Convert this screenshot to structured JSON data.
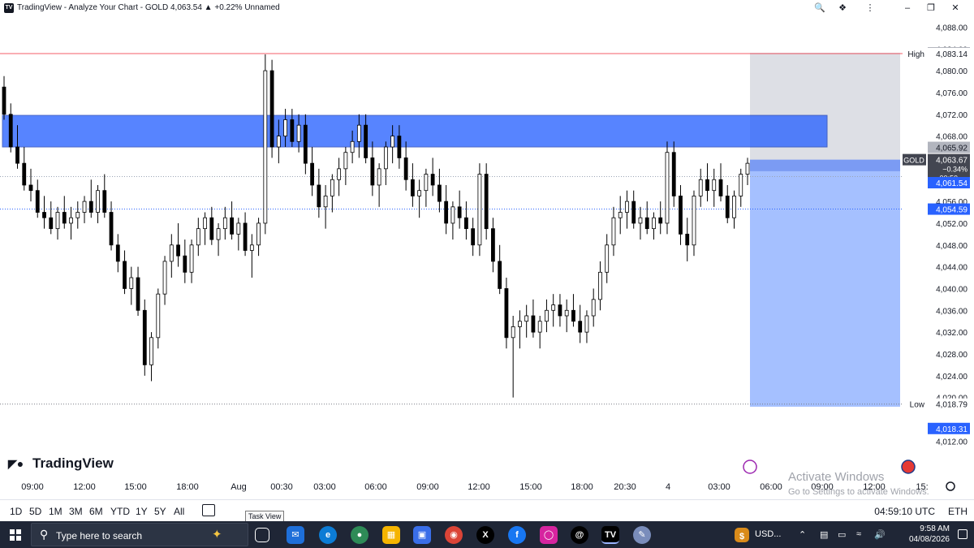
{
  "window": {
    "title": "TradingView - Analyze Your Chart - GOLD 4,063.54 ▲ +0.22% Unnamed",
    "app_icon": "TV",
    "icons": [
      "zoom-icon",
      "pin-icon",
      "extension-icon",
      "more-icon",
      "minimize-icon",
      "restore-icon",
      "close-icon"
    ]
  },
  "chart": {
    "symbol": "GOLD",
    "brand": "TradingView",
    "price_axis": {
      "ticks": [
        "4,088.00",
        "4,084.00",
        "4,080.00",
        "4,076.00",
        "4,072.00",
        "4,068.00",
        "4,064.00",
        "4,060.00",
        "4,056.00",
        "4,052.00",
        "4,048.00",
        "4,044.00",
        "4,040.00",
        "4,036.00",
        "4,032.00",
        "4,028.00",
        "4,024.00",
        "4,020.00",
        "4,012.00"
      ],
      "tick_values": [
        4088,
        4084,
        4080,
        4076,
        4072,
        4068,
        4064,
        4060,
        4056,
        4052,
        4048,
        4044,
        4040,
        4036,
        4032,
        4028,
        4024,
        4020,
        4012
      ]
    },
    "labels": {
      "high_label": "High",
      "high_value": "4,083.14",
      "high_top": "4,083.29",
      "zone_top": "4,065.92",
      "gold_tag": "GOLD",
      "gold_price": "4,063.67",
      "gold_change": "−0.34%",
      "gold_countdown": "00:50",
      "entry": "4,061.54",
      "blue_line": "4,054.59",
      "low_label": "Low",
      "low_value": "4,018.79",
      "low_bottom": "4,018.31"
    },
    "time_axis": [
      "09:00",
      "12:00",
      "15:00",
      "18:00",
      "Aug",
      "00:30",
      "03:00",
      "06:00",
      "09:00",
      "12:00",
      "15:00",
      "18:00",
      "20:30",
      "4",
      "03:00",
      "06:00",
      "09:00",
      "12:00",
      "15:"
    ],
    "watermark": {
      "title": "Activate Windows",
      "subtitle": "Go to Settings to activate Windows."
    },
    "colors": {
      "up": "#ffffff",
      "down": "#000000",
      "zone": "#2962ff",
      "stop_zone": "#d1d4dc",
      "target_zone": "#8fb0ff",
      "high_line": "#f23645",
      "dotted": "#2962ff"
    }
  },
  "chart_data": {
    "type": "candlestick",
    "symbol": "GOLD",
    "last": 4063.67,
    "high": 4083.14,
    "low": 4018.79,
    "ylim": [
      4011,
      4090
    ],
    "zones": {
      "supply": [
        4066.0,
        4071.8
      ],
      "sl": [
        4061.54,
        4083.29
      ],
      "entry_band": [
        4061.54,
        4063.67
      ],
      "tp": [
        4018.31,
        4061.54
      ]
    },
    "candles": [
      [
        4077,
        4079,
        4071,
        4072
      ],
      [
        4072,
        4074,
        4065,
        4066
      ],
      [
        4066,
        4070,
        4062,
        4063
      ],
      [
        4063,
        4066,
        4058,
        4059
      ],
      [
        4059,
        4062,
        4056,
        4058
      ],
      [
        4058,
        4060,
        4053,
        4054
      ],
      [
        4054,
        4057,
        4051,
        4053
      ],
      [
        4053,
        4056,
        4050,
        4051
      ],
      [
        4051,
        4055,
        4049,
        4054
      ],
      [
        4054,
        4057,
        4051,
        4052
      ],
      [
        4052,
        4055,
        4049,
        4053
      ],
      [
        4053,
        4056,
        4051,
        4054
      ],
      [
        4054,
        4057,
        4052,
        4056
      ],
      [
        4056,
        4060,
        4053,
        4054
      ],
      [
        4054,
        4059,
        4052,
        4058
      ],
      [
        4058,
        4061,
        4053,
        4054
      ],
      [
        4054,
        4056,
        4047,
        4048
      ],
      [
        4048,
        4050,
        4043,
        4045
      ],
      [
        4045,
        4047,
        4039,
        4040
      ],
      [
        4040,
        4044,
        4037,
        4042
      ],
      [
        4042,
        4044,
        4035,
        4036
      ],
      [
        4036,
        4038,
        4024,
        4026
      ],
      [
        4026,
        4032,
        4023,
        4031
      ],
      [
        4031,
        4040,
        4029,
        4039
      ],
      [
        4039,
        4046,
        4037,
        4045
      ],
      [
        4045,
        4050,
        4042,
        4048
      ],
      [
        4048,
        4052,
        4044,
        4046
      ],
      [
        4046,
        4049,
        4041,
        4043
      ],
      [
        4043,
        4049,
        4041,
        4048
      ],
      [
        4048,
        4053,
        4046,
        4051
      ],
      [
        4051,
        4054,
        4048,
        4053
      ],
      [
        4053,
        4055,
        4048,
        4049
      ],
      [
        4049,
        4052,
        4046,
        4051
      ],
      [
        4051,
        4055,
        4049,
        4053
      ],
      [
        4053,
        4056,
        4049,
        4050
      ],
      [
        4050,
        4053,
        4047,
        4052
      ],
      [
        4052,
        4054,
        4046,
        4047
      ],
      [
        4047,
        4050,
        4042,
        4048
      ],
      [
        4048,
        4053,
        4046,
        4052
      ],
      [
        4052,
        4083,
        4050,
        4080
      ],
      [
        4080,
        4082,
        4064,
        4066
      ],
      [
        4066,
        4071,
        4063,
        4068
      ],
      [
        4068,
        4073,
        4066,
        4071
      ],
      [
        4071,
        4073,
        4066,
        4067
      ],
      [
        4067,
        4072,
        4065,
        4070
      ],
      [
        4070,
        4072,
        4061,
        4063
      ],
      [
        4063,
        4066,
        4057,
        4059
      ],
      [
        4059,
        4062,
        4053,
        4055
      ],
      [
        4055,
        4059,
        4051,
        4057
      ],
      [
        4057,
        4061,
        4054,
        4060
      ],
      [
        4060,
        4064,
        4057,
        4062
      ],
      [
        4062,
        4066,
        4059,
        4065
      ],
      [
        4065,
        4069,
        4063,
        4067
      ],
      [
        4067,
        4072,
        4064,
        4070
      ],
      [
        4070,
        4072,
        4063,
        4064
      ],
      [
        4064,
        4067,
        4057,
        4059
      ],
      [
        4059,
        4063,
        4055,
        4062
      ],
      [
        4062,
        4067,
        4059,
        4066
      ],
      [
        4066,
        4070,
        4063,
        4068
      ],
      [
        4068,
        4070,
        4062,
        4064
      ],
      [
        4064,
        4067,
        4058,
        4060
      ],
      [
        4060,
        4063,
        4055,
        4057
      ],
      [
        4057,
        4060,
        4053,
        4058
      ],
      [
        4058,
        4062,
        4055,
        4061
      ],
      [
        4061,
        4064,
        4057,
        4059
      ],
      [
        4059,
        4062,
        4054,
        4056
      ],
      [
        4056,
        4059,
        4050,
        4052
      ],
      [
        4052,
        4056,
        4049,
        4055
      ],
      [
        4055,
        4058,
        4051,
        4053
      ],
      [
        4053,
        4056,
        4049,
        4051
      ],
      [
        4051,
        4053,
        4046,
        4048
      ],
      [
        4048,
        4063,
        4046,
        4061
      ],
      [
        4061,
        4063,
        4049,
        4051
      ],
      [
        4051,
        4053,
        4043,
        4045
      ],
      [
        4045,
        4048,
        4039,
        4040
      ],
      [
        4040,
        4042,
        4029,
        4031
      ],
      [
        4031,
        4035,
        4020,
        4033
      ],
      [
        4033,
        4036,
        4029,
        4034
      ],
      [
        4034,
        4037,
        4031,
        4035
      ],
      [
        4035,
        4038,
        4031,
        4032
      ],
      [
        4032,
        4035,
        4029,
        4034
      ],
      [
        4034,
        4038,
        4032,
        4036
      ],
      [
        4036,
        4039,
        4033,
        4037
      ],
      [
        4037,
        4039,
        4033,
        4035
      ],
      [
        4035,
        4038,
        4032,
        4036
      ],
      [
        4036,
        4039,
        4033,
        4034
      ],
      [
        4034,
        4037,
        4030,
        4032
      ],
      [
        4032,
        4036,
        4030,
        4035
      ],
      [
        4035,
        4040,
        4033,
        4038
      ],
      [
        4038,
        4045,
        4036,
        4043
      ],
      [
        4043,
        4050,
        4041,
        4048
      ],
      [
        4048,
        4055,
        4046,
        4053
      ],
      [
        4053,
        4057,
        4050,
        4054
      ],
      [
        4054,
        4058,
        4051,
        4056
      ],
      [
        4056,
        4058,
        4051,
        4052
      ],
      [
        4052,
        4055,
        4049,
        4053
      ],
      [
        4053,
        4056,
        4050,
        4051
      ],
      [
        4051,
        4054,
        4049,
        4053
      ],
      [
        4053,
        4056,
        4050,
        4052
      ],
      [
        4052,
        4067,
        4050,
        4065
      ],
      [
        4065,
        4067,
        4055,
        4057
      ],
      [
        4057,
        4059,
        4048,
        4050
      ],
      [
        4050,
        4053,
        4045,
        4048
      ],
      [
        4048,
        4058,
        4046,
        4057
      ],
      [
        4057,
        4062,
        4055,
        4060
      ],
      [
        4060,
        4063,
        4056,
        4058
      ],
      [
        4058,
        4062,
        4055,
        4060
      ],
      [
        4060,
        4063,
        4056,
        4057
      ],
      [
        4057,
        4059,
        4052,
        4053
      ],
      [
        4053,
        4058,
        4051,
        4057
      ],
      [
        4057,
        4062,
        4055,
        4061
      ],
      [
        4061,
        4064,
        4059,
        4063
      ]
    ]
  },
  "footer": {
    "ranges": [
      "1D",
      "5D",
      "1M",
      "3M",
      "6M",
      "YTD",
      "1Y",
      "5Y",
      "All"
    ],
    "clock": "04:59:10 UTC",
    "timezone": "ETH",
    "tooltip": "Task View"
  },
  "taskbar": {
    "search_placeholder": "Type here to search",
    "apps": [
      "task-view",
      "mail",
      "edge",
      "chrome-profile",
      "file-explorer",
      "store",
      "chrome",
      "x",
      "facebook",
      "instagram",
      "threads",
      "tradingview",
      "paint"
    ],
    "currency": "USD...",
    "time": "9:58 AM",
    "date": "04/08/2026"
  }
}
